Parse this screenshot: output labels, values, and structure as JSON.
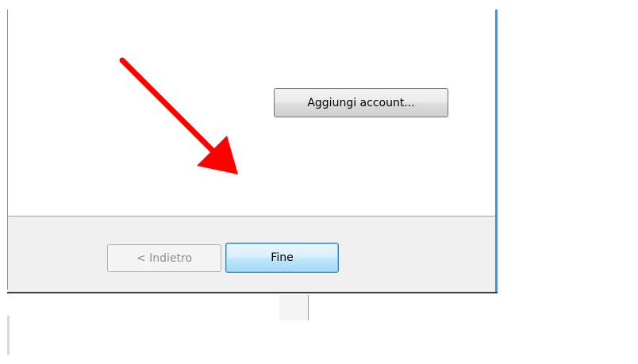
{
  "dialog": {
    "add_account_button": "Aggiungi account...",
    "back_button": "< Indietro",
    "finish_button": "Fine"
  },
  "annotation": {
    "arrow_icon": "red-arrow-icon",
    "arrow_color": "#ff0000"
  },
  "colors": {
    "window_border_accent": "#5a8fbf",
    "button_panel_background": "#f0f0f0",
    "default_button_border": "#3c7fb1"
  }
}
